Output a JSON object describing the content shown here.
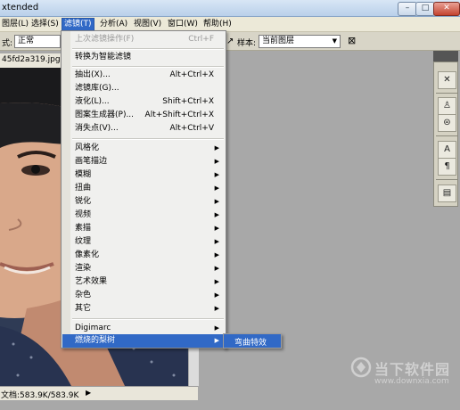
{
  "window": {
    "title": "xtended"
  },
  "menubar": {
    "items": [
      "图层(L)",
      "选择(S)",
      "滤镜(T)",
      "分析(A)",
      "视图(V)",
      "窗口(W)",
      "帮助(H)"
    ]
  },
  "options_bar": {
    "mode_label": "式:",
    "mode_value": "正常",
    "sample_label": "样本:",
    "sample_value": "当前图层"
  },
  "document": {
    "tab_title": "45fd2a319.jpg @",
    "status": "文档:583.9K/583.9K"
  },
  "filter_menu": {
    "items": [
      {
        "label": "上次滤镜操作(F)",
        "shortcut": "Ctrl+F",
        "disabled": true
      },
      {
        "label": "转换为智能滤镜"
      },
      {
        "label": "抽出(X)...",
        "shortcut": "Alt+Ctrl+X"
      },
      {
        "label": "滤镜库(G)..."
      },
      {
        "label": "液化(L)...",
        "shortcut": "Shift+Ctrl+X"
      },
      {
        "label": "图案生成器(P)...",
        "shortcut": "Alt+Shift+Ctrl+X"
      },
      {
        "label": "消失点(V)...",
        "shortcut": "Alt+Ctrl+V"
      },
      {
        "label": "风格化",
        "submenu": true
      },
      {
        "label": "画笔描边",
        "submenu": true
      },
      {
        "label": "模糊",
        "submenu": true
      },
      {
        "label": "扭曲",
        "submenu": true
      },
      {
        "label": "锐化",
        "submenu": true
      },
      {
        "label": "视频",
        "submenu": true
      },
      {
        "label": "素描",
        "submenu": true
      },
      {
        "label": "纹理",
        "submenu": true
      },
      {
        "label": "像素化",
        "submenu": true
      },
      {
        "label": "渲染",
        "submenu": true
      },
      {
        "label": "艺术效果",
        "submenu": true
      },
      {
        "label": "杂色",
        "submenu": true
      },
      {
        "label": "其它",
        "submenu": true
      },
      {
        "label": "Digimarc",
        "submenu": true
      },
      {
        "label": "燃烧的梨树",
        "submenu": true,
        "highlighted": true
      }
    ],
    "submenu_item": "弯曲特效"
  },
  "watermark": {
    "text": "当下软件园",
    "url": "www.downxia.com"
  },
  "colors": {
    "highlight": "#3169c6",
    "menu_bg": "#f0f0ee",
    "workspace": "#a8a8a8"
  }
}
